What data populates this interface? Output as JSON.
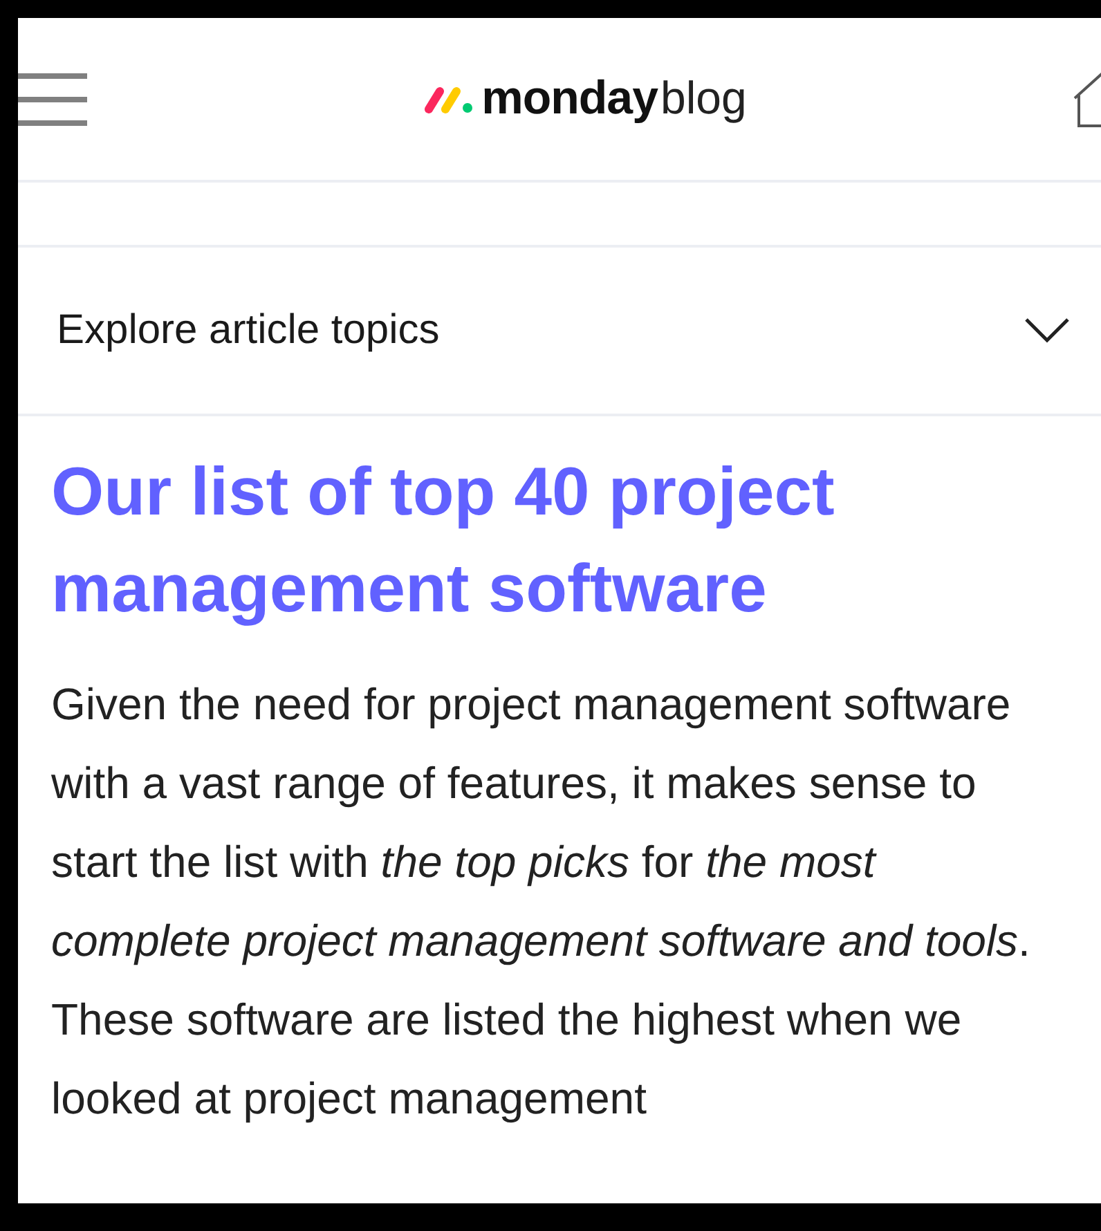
{
  "header": {
    "brand": "monday",
    "suffix": "blog"
  },
  "topics": {
    "label": "Explore article topics",
    "expanded": false
  },
  "article": {
    "title": "Our list of top 40 project management software",
    "intro": "Given the need for project management software with a vast range of features, it makes sense to start the list with *the top picks* for *the most complete project management software and tools*. These software are listed the highest when we looked at project management"
  }
}
